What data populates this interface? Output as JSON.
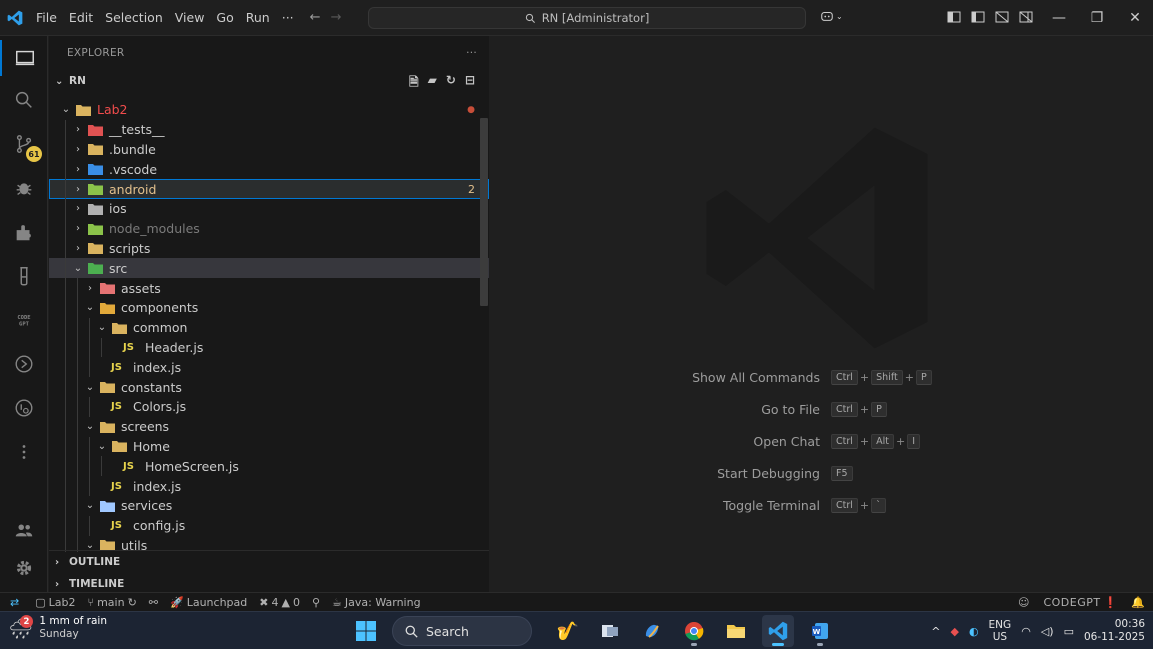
{
  "titlebar": {
    "menu": [
      "File",
      "Edit",
      "Selection",
      "View",
      "Go",
      "Run",
      "···"
    ],
    "command_center": "RN [Administrator]"
  },
  "activity": {
    "scm_badge": "61"
  },
  "explorer": {
    "header": "EXPLORER",
    "more": "···",
    "root": "RN",
    "items": [
      {
        "label": "Lab2",
        "depth": 0,
        "open": true,
        "kind": "folder",
        "status": "●"
      },
      {
        "label": "__tests__",
        "depth": 1,
        "open": false,
        "kind": "folder-tests"
      },
      {
        "label": ".bundle",
        "depth": 1,
        "open": false,
        "kind": "folder"
      },
      {
        "label": ".vscode",
        "depth": 1,
        "open": false,
        "kind": "folder-vscode"
      },
      {
        "label": "android",
        "depth": 1,
        "open": false,
        "kind": "folder-android",
        "status": "2"
      },
      {
        "label": "ios",
        "depth": 1,
        "open": false,
        "kind": "folder-ios"
      },
      {
        "label": "node_modules",
        "depth": 1,
        "open": false,
        "kind": "folder-node"
      },
      {
        "label": "scripts",
        "depth": 1,
        "open": false,
        "kind": "folder"
      },
      {
        "label": "src",
        "depth": 1,
        "open": true,
        "kind": "folder-src"
      },
      {
        "label": "assets",
        "depth": 2,
        "open": false,
        "kind": "folder-assets"
      },
      {
        "label": "components",
        "depth": 2,
        "open": true,
        "kind": "folder-comp"
      },
      {
        "label": "common",
        "depth": 3,
        "open": true,
        "kind": "folder"
      },
      {
        "label": "Header.js",
        "depth": 4,
        "kind": "js"
      },
      {
        "label": "index.js",
        "depth": 3,
        "kind": "js"
      },
      {
        "label": "constants",
        "depth": 2,
        "open": true,
        "kind": "folder"
      },
      {
        "label": "Colors.js",
        "depth": 3,
        "kind": "js"
      },
      {
        "label": "screens",
        "depth": 2,
        "open": true,
        "kind": "folder"
      },
      {
        "label": "Home",
        "depth": 3,
        "open": true,
        "kind": "folder"
      },
      {
        "label": "HomeScreen.js",
        "depth": 4,
        "kind": "js"
      },
      {
        "label": "index.js",
        "depth": 3,
        "kind": "js"
      },
      {
        "label": "services",
        "depth": 2,
        "open": true,
        "kind": "folder-services"
      },
      {
        "label": "config.js",
        "depth": 3,
        "kind": "js"
      },
      {
        "label": "utils",
        "depth": 2,
        "open": true,
        "kind": "folder-utils"
      }
    ],
    "outline": "OUTLINE",
    "timeline": "TIMELINE"
  },
  "shortcuts": [
    {
      "label": "Show All Commands",
      "keys": [
        "Ctrl",
        "Shift",
        "P"
      ]
    },
    {
      "label": "Go to File",
      "keys": [
        "Ctrl",
        "P"
      ]
    },
    {
      "label": "Open Chat",
      "keys": [
        "Ctrl",
        "Alt",
        "I"
      ]
    },
    {
      "label": "Start Debugging",
      "keys": [
        "F5"
      ]
    },
    {
      "label": "Toggle Terminal",
      "keys": [
        "Ctrl",
        "`"
      ]
    }
  ],
  "statusbar": {
    "folder": "Lab2",
    "branch": "main",
    "launchpad": "Launchpad",
    "errors": "4",
    "warnings": "0",
    "java": "Java: Warning",
    "codegpt": "CODEGPT"
  },
  "taskbar": {
    "weather_badge": "2",
    "weather_line1": "1 mm of rain",
    "weather_line2": "Sunday",
    "search": "Search",
    "lang1": "ENG",
    "lang2": "US",
    "time": "00:36",
    "date": "06-11-2025"
  },
  "colors": {
    "accent": "#0078d4",
    "error": "#f14c4c",
    "modified": "#e2c08d",
    "badge": "#e7c547"
  }
}
